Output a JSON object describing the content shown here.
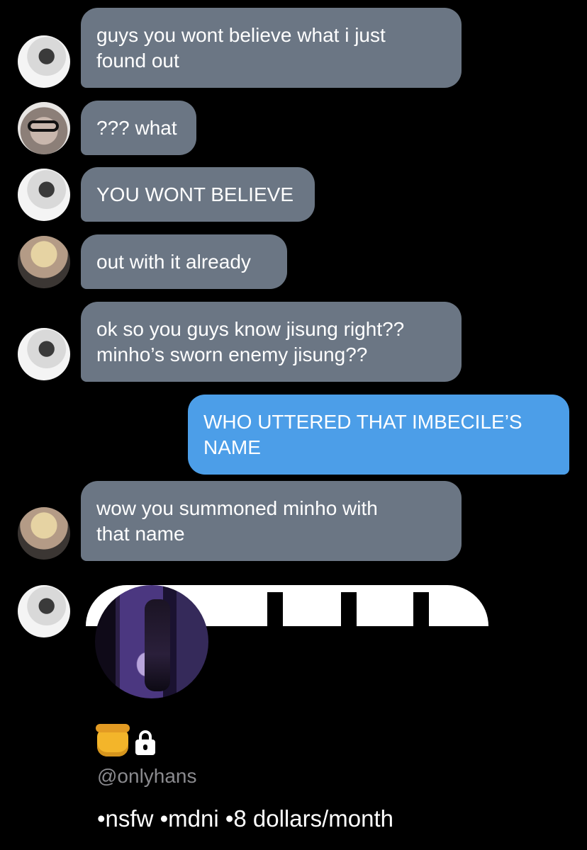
{
  "messages": [
    {
      "text": "guys you wont believe what i just\nfound out"
    },
    {
      "text": "??? what"
    },
    {
      "text": "YOU WONT BELIEVE"
    },
    {
      "text": "out with it already"
    },
    {
      "text": "ok so you guys know jisung right??\nminho’s sworn enemy jisung??"
    },
    {
      "text": "WHO UTTERED THAT IMBECILE’S\nNAME"
    },
    {
      "text": "wow you summoned minho with\nthat name"
    }
  ],
  "profile": {
    "handle": "@onlyhans",
    "bio": "•nsfw •mdni •8 dollars/month",
    "icons": [
      "honey-pot-icon",
      "lock-icon"
    ]
  },
  "colors": {
    "background": "#000000",
    "incoming_bubble": "#6b7684",
    "outgoing_bubble": "#4c9ee8"
  }
}
